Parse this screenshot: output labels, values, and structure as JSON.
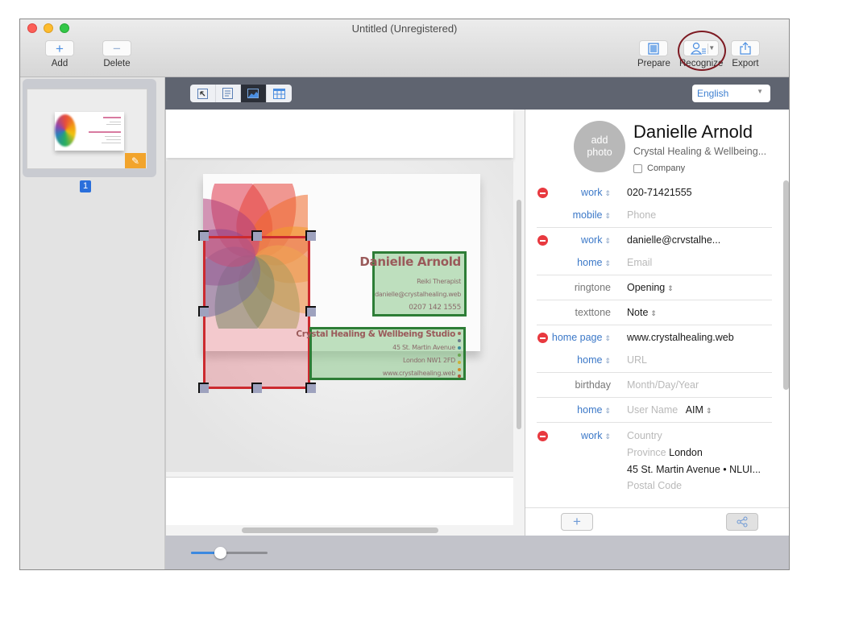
{
  "window": {
    "title": "Untitled (Unregistered)"
  },
  "toolbar": {
    "add_label": "Add",
    "delete_label": "Delete",
    "prepare_label": "Prepare",
    "recognize_label": "Recognize",
    "export_label": "Export",
    "icons": {
      "add": "plus-icon",
      "delete": "minus-icon",
      "prepare": "document-icon",
      "recognize": "contact-card-icon",
      "export": "share-upload-icon"
    }
  },
  "sidebar": {
    "pages": [
      {
        "number": "1",
        "edit_icon": "pencil-icon",
        "selected": true
      }
    ]
  },
  "view_modes": [
    {
      "name": "select-mode",
      "icon": "arrow-cursor-icon",
      "active": false
    },
    {
      "name": "text-mode",
      "icon": "text-lines-icon",
      "active": false
    },
    {
      "name": "image-mode",
      "icon": "image-icon",
      "active": true
    },
    {
      "name": "table-mode",
      "icon": "table-grid-icon",
      "active": false
    }
  ],
  "language": {
    "selected": "English"
  },
  "business_card": {
    "name": "Danielle Arnold",
    "title": "Reiki Therapist",
    "email": "danielle@crystalhealing.web",
    "phone": "0207 142 1555",
    "company": "Crystal Healing & Wellbeing Studio",
    "street": "45 St. Martin Avenue",
    "city": "London NW1 2FD",
    "website": "www.crystalhealing.web"
  },
  "zoom": {
    "level_fraction": 0.38
  },
  "contact": {
    "avatar_label_1": "add",
    "avatar_label_2": "photo",
    "name": "Danielle Arnold",
    "company": "Crystal Healing & Wellbeing...",
    "company_checkbox_label": "Company",
    "company_checked": false,
    "rows": {
      "phone_work": {
        "label": "work",
        "value": "020-71421555"
      },
      "phone_mobile": {
        "label": "mobile",
        "placeholder": "Phone"
      },
      "email_work": {
        "label": "work",
        "value": "danielle@crvstalhe..."
      },
      "email_home": {
        "label": "home",
        "placeholder": "Email"
      },
      "ringtone": {
        "label": "ringtone",
        "value": "Opening"
      },
      "texttone": {
        "label": "texttone",
        "value": "Note"
      },
      "url_homepage": {
        "label": "home page",
        "value": "www.crystalhealing.web"
      },
      "url_home": {
        "label": "home",
        "placeholder": "URL"
      },
      "birthday": {
        "label": "birthday",
        "placeholder": "Month/Day/Year"
      },
      "im_home": {
        "label": "home",
        "placeholder": "User Name",
        "service": "AIM"
      },
      "address_work": {
        "label": "work",
        "country_placeholder": "Country",
        "province_placeholder": "Province",
        "province_value": "London",
        "street_value": "45 St. Martin Avenue •  NLUI...",
        "postal_placeholder": "Postal Code"
      }
    },
    "footer": {
      "add_icon": "plus-icon",
      "share_icon": "share-nodes-icon"
    }
  },
  "colors": {
    "accent_blue": "#3b78c8",
    "remove_red": "#e8393f",
    "selection_red": "#cc2a2f",
    "selection_green": "#2d7d36",
    "edit_orange": "#f2a42c",
    "annotation_circle": "#7d1a22"
  }
}
